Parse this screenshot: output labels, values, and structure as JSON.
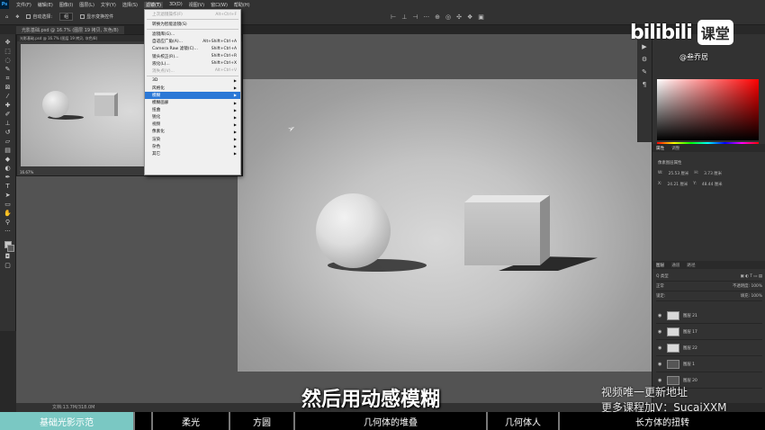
{
  "menubar": {
    "items": [
      "文件(F)",
      "编辑(E)",
      "图像(I)",
      "图层(L)",
      "文字(Y)",
      "选择(S)",
      "滤镜(T)",
      "3D(D)",
      "视图(V)",
      "窗口(W)",
      "帮助(H)"
    ],
    "active_index": 6
  },
  "options": {
    "auto_select_label": "自动选择:",
    "auto_select_value": "组",
    "transform_label": "显示变换控件"
  },
  "tabs": [
    "光影基础.psd @ 16.7% (图层 19 拷贝, 灰色/8)"
  ],
  "float_window": {
    "title": "光影基础.psd @ 16.7% (图层 19 拷贝, 灰色/8)",
    "zoom": "16.67%"
  },
  "filter_menu": {
    "items": [
      {
        "label": "上次滤镜操作(F)",
        "shortcut": "Alt+Ctrl+F",
        "disabled": true
      },
      {
        "sep": true
      },
      {
        "label": "转换为智能滤镜(S)",
        "shortcut": ""
      },
      {
        "sep": true
      },
      {
        "label": "滤镜库(G)...",
        "shortcut": ""
      },
      {
        "label": "自适应广角(A)...",
        "shortcut": "Alt+Shift+Ctrl+A"
      },
      {
        "label": "Camera Raw 滤镜(C)...",
        "shortcut": "Shift+Ctrl+A"
      },
      {
        "label": "镜头校正(R)...",
        "shortcut": "Shift+Ctrl+R"
      },
      {
        "label": "液化(L)...",
        "shortcut": "Shift+Ctrl+X"
      },
      {
        "label": "消失点(V)...",
        "shortcut": "Alt+Ctrl+V",
        "disabled": true
      },
      {
        "sep": true
      },
      {
        "label": "3D",
        "submenu": true
      },
      {
        "label": "风格化",
        "submenu": true
      },
      {
        "label": "模糊",
        "submenu": true,
        "highlight": true
      },
      {
        "label": "模糊画廊",
        "submenu": true
      },
      {
        "label": "扭曲",
        "submenu": true
      },
      {
        "label": "锐化",
        "submenu": true
      },
      {
        "label": "视频",
        "submenu": true
      },
      {
        "label": "像素化",
        "submenu": true
      },
      {
        "label": "渲染",
        "submenu": true
      },
      {
        "label": "杂色",
        "submenu": true
      },
      {
        "label": "其它",
        "submenu": true
      }
    ]
  },
  "panels": {
    "properties_tabs": [
      "属性",
      "调整"
    ],
    "properties_header": "像素图层属性",
    "w_label": "W:",
    "w_value": "25.53 厘米",
    "h_label": "H:",
    "h_value": "3.73 厘米",
    "x_label": "X:",
    "x_value": "24.21 厘米",
    "y_label": "Y:",
    "y_value": "48.44 厘米",
    "layers_tabs": [
      "图层",
      "通道",
      "路径"
    ],
    "kind_label": "Q 类型",
    "blend_mode": "正常",
    "opacity_label": "不透明度:",
    "opacity_value": "100%",
    "lock_label": "锁定:",
    "fill_label": "填充:",
    "fill_value": "100%",
    "layers": [
      "图层 21",
      "图层 17",
      "图层 22",
      "图层 1",
      "图层 20"
    ]
  },
  "watermark": {
    "logo": "bilibili",
    "course": "课堂",
    "author": "@叁乔居"
  },
  "subtitle": "然后用动感模糊",
  "promo": [
    "视频唯一更新地址",
    "更多课程加V：SucaiXXM"
  ],
  "status": "文档:13.7M/318.0M",
  "chapters": [
    {
      "label": "基础光影示范",
      "active": true
    },
    {
      "label": "柔光"
    },
    {
      "label": "方圆"
    },
    {
      "label": "几何体的堆叠"
    },
    {
      "label": "几何体人"
    },
    {
      "label": "长方体的扭转"
    }
  ]
}
